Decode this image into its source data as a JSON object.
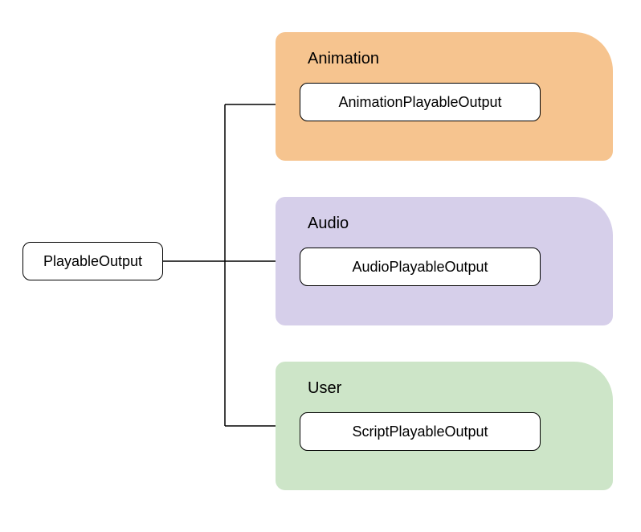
{
  "root": {
    "label": "PlayableOutput"
  },
  "categories": {
    "animation": {
      "title": "Animation",
      "child_label": "AnimationPlayableOutput",
      "color": "#f6c48f"
    },
    "audio": {
      "title": "Audio",
      "child_label": "AudioPlayableOutput",
      "color": "#d6cfea"
    },
    "user": {
      "title": "User",
      "child_label": "ScriptPlayableOutput",
      "color": "#cde5c8"
    }
  }
}
